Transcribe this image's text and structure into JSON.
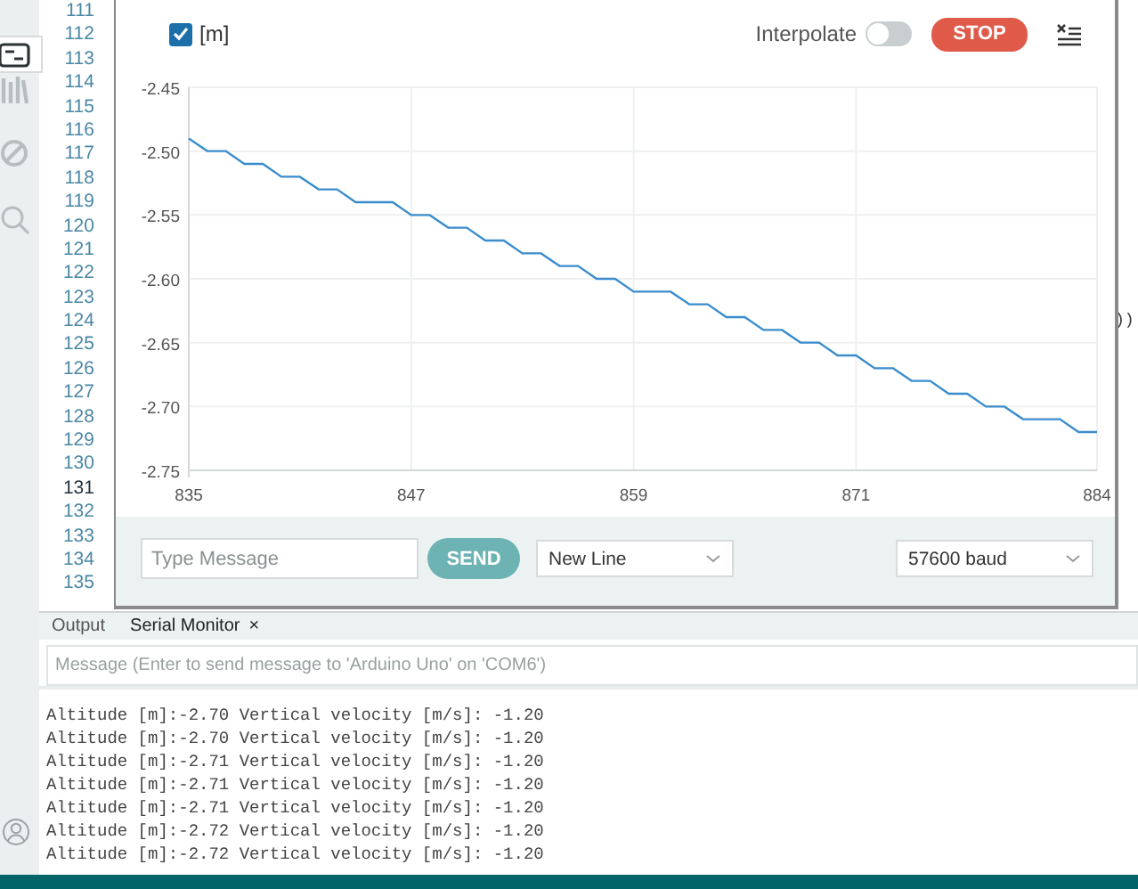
{
  "activity_bar": {
    "items": [
      {
        "kind": "board",
        "selected": true
      },
      {
        "kind": "library",
        "selected": false
      },
      {
        "kind": "debug",
        "selected": false
      },
      {
        "kind": "search",
        "selected": false
      }
    ]
  },
  "editor": {
    "lines": [
      {
        "number": "111",
        "current": false
      },
      {
        "number": "112",
        "current": false
      },
      {
        "number": "113",
        "current": false
      },
      {
        "number": "114",
        "current": false
      },
      {
        "number": "115",
        "current": false
      },
      {
        "number": "116",
        "current": false
      },
      {
        "number": "117",
        "current": false
      },
      {
        "number": "118",
        "current": false
      },
      {
        "number": "119",
        "current": false
      },
      {
        "number": "120",
        "current": false
      },
      {
        "number": "121",
        "current": false
      },
      {
        "number": "122",
        "current": false
      },
      {
        "number": "123",
        "current": false
      },
      {
        "number": "124",
        "current": false,
        "code": "))"
      },
      {
        "number": "125",
        "current": false
      },
      {
        "number": "126",
        "current": false
      },
      {
        "number": "127",
        "current": false
      },
      {
        "number": "128",
        "current": false
      },
      {
        "number": "129",
        "current": false
      },
      {
        "number": "130",
        "current": false
      },
      {
        "number": "131",
        "current": true
      },
      {
        "number": "132",
        "current": false
      },
      {
        "number": "133",
        "current": false
      },
      {
        "number": "134",
        "current": false
      },
      {
        "number": "135",
        "current": false
      }
    ]
  },
  "plotter": {
    "series_toggle": {
      "checked": true
    },
    "interpolate": {
      "label": "Interpolate",
      "on": false
    },
    "stop_button": "STOP",
    "chart_data": {
      "type": "line",
      "x": [
        835,
        836,
        837,
        838,
        839,
        840,
        841,
        842,
        843,
        844,
        845,
        846,
        847,
        848,
        849,
        850,
        851,
        852,
        853,
        854,
        855,
        856,
        857,
        858,
        859,
        860,
        861,
        862,
        863,
        864,
        865,
        866,
        867,
        868,
        869,
        870,
        871,
        872,
        873,
        874,
        875,
        876,
        877,
        878,
        879,
        880,
        881,
        882,
        883,
        884
      ],
      "series": [
        {
          "name": "[m]",
          "color": "#3a8ccc",
          "values": [
            -2.49,
            -2.5,
            -2.5,
            -2.51,
            -2.51,
            -2.52,
            -2.52,
            -2.53,
            -2.53,
            -2.54,
            -2.54,
            -2.54,
            -2.55,
            -2.55,
            -2.56,
            -2.56,
            -2.57,
            -2.57,
            -2.58,
            -2.58,
            -2.59,
            -2.59,
            -2.6,
            -2.6,
            -2.61,
            -2.61,
            -2.61,
            -2.62,
            -2.62,
            -2.63,
            -2.63,
            -2.64,
            -2.64,
            -2.65,
            -2.65,
            -2.66,
            -2.66,
            -2.67,
            -2.67,
            -2.68,
            -2.68,
            -2.69,
            -2.69,
            -2.7,
            -2.7,
            -2.71,
            -2.71,
            -2.71,
            -2.72,
            -2.72
          ]
        }
      ],
      "grid": true,
      "xlim": [
        835,
        884
      ],
      "ylim": [
        -2.75,
        -2.45
      ],
      "xticks": [
        835,
        847,
        859,
        871,
        884
      ],
      "yticks": [
        {
          "value": -2.45,
          "label": "-2.45"
        },
        {
          "value": -2.5,
          "label": "-2.50"
        },
        {
          "value": -2.55,
          "label": "-2.55"
        },
        {
          "value": -2.6,
          "label": "-2.60"
        },
        {
          "value": -2.65,
          "label": "-2.65"
        },
        {
          "value": -2.7,
          "label": "-2.70"
        },
        {
          "value": -2.75,
          "label": "-2.75"
        }
      ]
    },
    "message": {
      "placeholder": "Type Message"
    },
    "send_button": "SEND",
    "line_ending": "New Line",
    "baud_rate": "57600 baud"
  },
  "panel": {
    "tabs": [
      {
        "label": "Output",
        "selected": false
      },
      {
        "label": "Serial Monitor",
        "selected": true,
        "close": "×"
      }
    ],
    "message": {
      "placeholder": "Message (Enter to send message to 'Arduino Uno' on 'COM6')"
    },
    "output": [
      "Altitude [m]:-2.70 Vertical velocity [m/s]: -1.20",
      "Altitude [m]:-2.70 Vertical velocity [m/s]: -1.20",
      "Altitude [m]:-2.71 Vertical velocity [m/s]: -1.20",
      "Altitude [m]:-2.71 Vertical velocity [m/s]: -1.20",
      "Altitude [m]:-2.71 Vertical velocity [m/s]: -1.20",
      "Altitude [m]:-2.72 Vertical velocity [m/s]: -1.20",
      "Altitude [m]:-2.72 Vertical velocity [m/s]: -1.20"
    ]
  }
}
